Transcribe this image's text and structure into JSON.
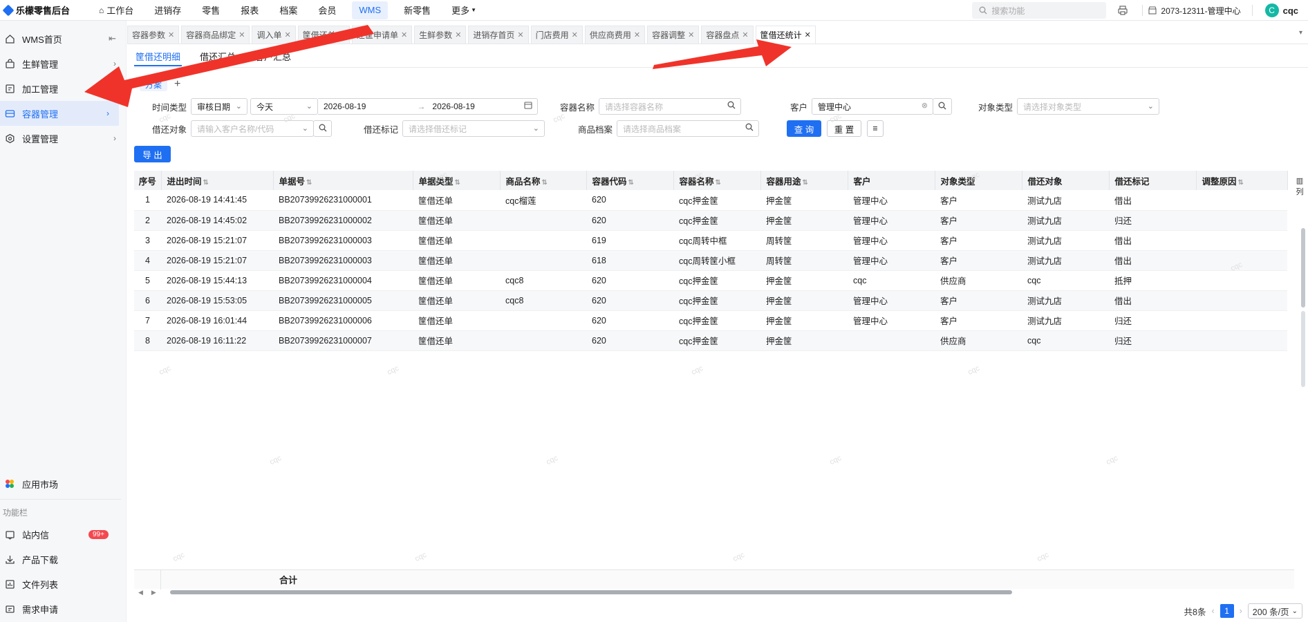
{
  "topbar": {
    "brand": "乐檬零售后台",
    "nav": [
      "工作台",
      "进销存",
      "零售",
      "报表",
      "档案",
      "会员",
      "WMS",
      "新零售",
      "更多"
    ],
    "nav_active": "WMS",
    "search_placeholder": "搜索功能",
    "store": "2073-12311-管理中心",
    "avatar_letter": "C",
    "username": "cqc"
  },
  "sidebar": {
    "items": [
      {
        "label": "WMS首页",
        "icon": "home-icon"
      },
      {
        "label": "生鲜管理",
        "icon": "bag-icon"
      },
      {
        "label": "加工管理",
        "icon": "processing-icon"
      },
      {
        "label": "容器管理",
        "icon": "container-icon"
      },
      {
        "label": "设置管理",
        "icon": "gear-icon"
      }
    ],
    "active": "容器管理",
    "app_market": "应用市场",
    "group_label": "功能栏",
    "bottom_items": [
      {
        "label": "站内信",
        "icon": "message-icon",
        "badge": "99+"
      },
      {
        "label": "产品下载",
        "icon": "download-icon"
      },
      {
        "label": "文件列表",
        "icon": "file-list-icon"
      },
      {
        "label": "需求申请",
        "icon": "request-icon"
      }
    ]
  },
  "page_tabs": [
    "容器参数",
    "容器商品绑定",
    "调入单",
    "筐借还单",
    "还筐申请单",
    "生鲜参数",
    "进销存首页",
    "门店费用",
    "供应商费用",
    "容器调整",
    "容器盘点",
    "筐借还统计"
  ],
  "page_tab_active": "筐借还统计",
  "sub_tabs": [
    "筐借还明细",
    "借还汇总",
    "客户汇总"
  ],
  "sub_tab_active": "筐借还明细",
  "filter_pill": "方案",
  "filters": {
    "time_type_label": "时间类型",
    "time_type_value": "审核日期",
    "period_value": "今天",
    "date_from": "2026-08-19",
    "date_to": "2026-08-19",
    "container_name_label": "容器名称",
    "container_name_placeholder": "请选择容器名称",
    "customer_label": "客户",
    "customer_value": "管理中心",
    "object_type_label": "对象类型",
    "object_type_placeholder": "请选择对象类型",
    "borrow_object_label": "借还对象",
    "borrow_object_placeholder": "请输入客户名称/代码",
    "borrow_mark_label": "借还标记",
    "borrow_mark_placeholder": "请选择借还标记",
    "goods_label": "商品档案",
    "goods_placeholder": "请选择商品档案",
    "query_button": "查 询",
    "reset_button": "重 置",
    "export_button": "导 出"
  },
  "table": {
    "columns": [
      "序号",
      "进出时间",
      "单据号",
      "单据类型",
      "商品名称",
      "容器代码",
      "容器名称",
      "容器用途",
      "客户",
      "对象类型",
      "借还对象",
      "借还标记",
      "调整原因"
    ],
    "rows": [
      [
        "1",
        "2026-08-19 14:41:45",
        "BB20739926231000001",
        "筐借还单",
        "cqc榴莲",
        "620",
        "cqc押金筐",
        "押金筐",
        "管理中心",
        "客户",
        "测试九店",
        "借出",
        ""
      ],
      [
        "2",
        "2026-08-19 14:45:02",
        "BB20739926231000002",
        "筐借还单",
        "",
        "620",
        "cqc押金筐",
        "押金筐",
        "管理中心",
        "客户",
        "测试九店",
        "归还",
        ""
      ],
      [
        "3",
        "2026-08-19 15:21:07",
        "BB20739926231000003",
        "筐借还单",
        "",
        "619",
        "cqc周转中框",
        "周转筐",
        "管理中心",
        "客户",
        "测试九店",
        "借出",
        ""
      ],
      [
        "4",
        "2026-08-19 15:21:07",
        "BB20739926231000003",
        "筐借还单",
        "",
        "618",
        "cqc周转筐小框",
        "周转筐",
        "管理中心",
        "客户",
        "测试九店",
        "借出",
        ""
      ],
      [
        "5",
        "2026-08-19 15:44:13",
        "BB20739926231000004",
        "筐借还单",
        "cqc8",
        "620",
        "cqc押金筐",
        "押金筐",
        "cqc",
        "供应商",
        "cqc",
        "抵押",
        ""
      ],
      [
        "6",
        "2026-08-19 15:53:05",
        "BB20739926231000005",
        "筐借还单",
        "cqc8",
        "620",
        "cqc押金筐",
        "押金筐",
        "管理中心",
        "客户",
        "测试九店",
        "借出",
        ""
      ],
      [
        "7",
        "2026-08-19 16:01:44",
        "BB20739926231000006",
        "筐借还单",
        "",
        "620",
        "cqc押金筐",
        "押金筐",
        "管理中心",
        "客户",
        "测试九店",
        "归还",
        ""
      ],
      [
        "8",
        "2026-08-19 16:11:22",
        "BB20739926231000007",
        "筐借还单",
        "",
        "620",
        "cqc押金筐",
        "押金筐",
        "",
        "供应商",
        "cqc",
        "归还",
        ""
      ]
    ],
    "total_label": "合计",
    "column_setting_label": "列"
  },
  "pager": {
    "total": "共8条",
    "page": "1",
    "page_size": "200 条/页"
  },
  "watermark": "cqc",
  "colors": {
    "accent": "#1f6ff2",
    "annotation_arrow": "#f0332a",
    "badge": "#f5484f"
  }
}
